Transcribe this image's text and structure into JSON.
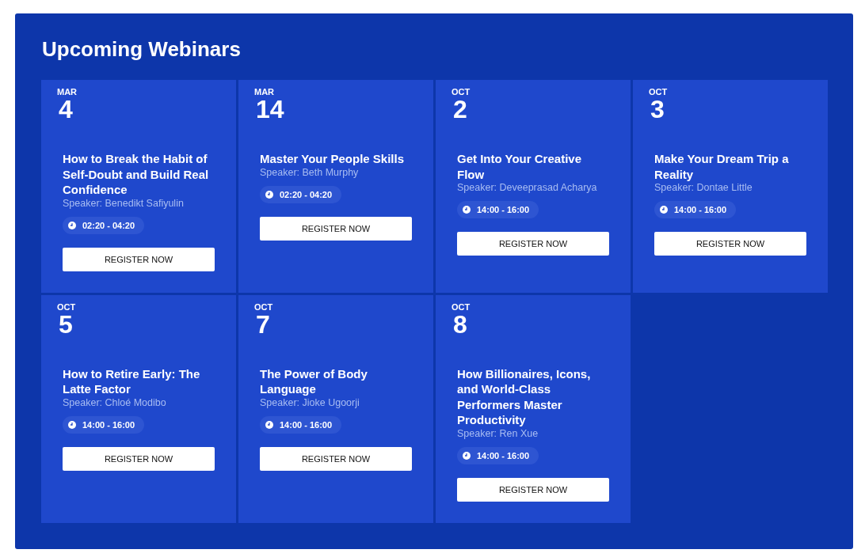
{
  "title": "Upcoming Webinars",
  "webinars": [
    {
      "month": "MAR",
      "day": "4",
      "title": "How to Break the Habit of Self-Doubt and Build Real Confidence",
      "speaker": "Speaker: Benedikt Safiyulin",
      "time": "02:20 - 04:20",
      "button": "REGISTER NOW"
    },
    {
      "month": "MAR",
      "day": "14",
      "title": "Master Your People Skills",
      "speaker": "Speaker: Beth Murphy",
      "time": "02:20 - 04:20",
      "button": "REGISTER NOW"
    },
    {
      "month": "OCT",
      "day": "2",
      "title": "Get Into Your Creative Flow",
      "speaker": "Speaker: Deveeprasad Acharya",
      "time": "14:00 - 16:00",
      "button": "REGISTER NOW"
    },
    {
      "month": "OCT",
      "day": "3",
      "title": "Make Your Dream Trip a Reality",
      "speaker": "Speaker: Dontae Little",
      "time": "14:00 - 16:00",
      "button": "REGISTER NOW"
    },
    {
      "month": "OCT",
      "day": "5",
      "title": "How to Retire Early: The Latte Factor",
      "speaker": "Speaker: Chloé Modibo",
      "time": "14:00 - 16:00",
      "button": "REGISTER NOW"
    },
    {
      "month": "OCT",
      "day": "7",
      "title": "The Power of Body Language",
      "speaker": "Speaker: Jioke Ugoorji",
      "time": "14:00 - 16:00",
      "button": "REGISTER NOW"
    },
    {
      "month": "OCT",
      "day": "8",
      "title": "How Billionaires, Icons, and World-Class Performers Master Productivity",
      "speaker": "Speaker: Ren Xue",
      "time": "14:00 - 16:00",
      "button": "REGISTER NOW"
    }
  ]
}
